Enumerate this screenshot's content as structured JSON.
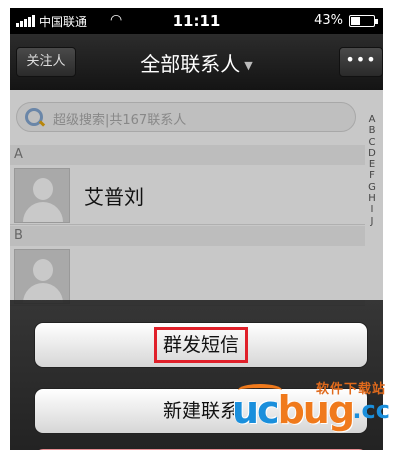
{
  "status_bar": {
    "carrier": "中国联通",
    "time": "11:11",
    "battery_percent": "43%",
    "battery_level": 0.43
  },
  "nav": {
    "left_button": "关注人",
    "title": "全部联系人",
    "more_button": "•••"
  },
  "search": {
    "placeholder": "超级搜索|共167联系人"
  },
  "index_letters": [
    "A",
    "B",
    "C",
    "D",
    "E",
    "F",
    "G",
    "H",
    "I",
    "J"
  ],
  "sections": [
    {
      "header": "A",
      "contacts": [
        {
          "name": "艾普刘"
        }
      ]
    },
    {
      "header": "B",
      "contacts": [
        {
          "name": ""
        }
      ]
    }
  ],
  "action_sheet": {
    "mass_sms": "群发短信",
    "new_contact": "新建联系",
    "highlight_color": "#e0202a",
    "cancel_color": "#d0545a"
  },
  "watermark": {
    "top_text": "软件下载站",
    "logo_part1": "uc",
    "logo_part2": "bug",
    "logo_suffix": ".cc"
  }
}
